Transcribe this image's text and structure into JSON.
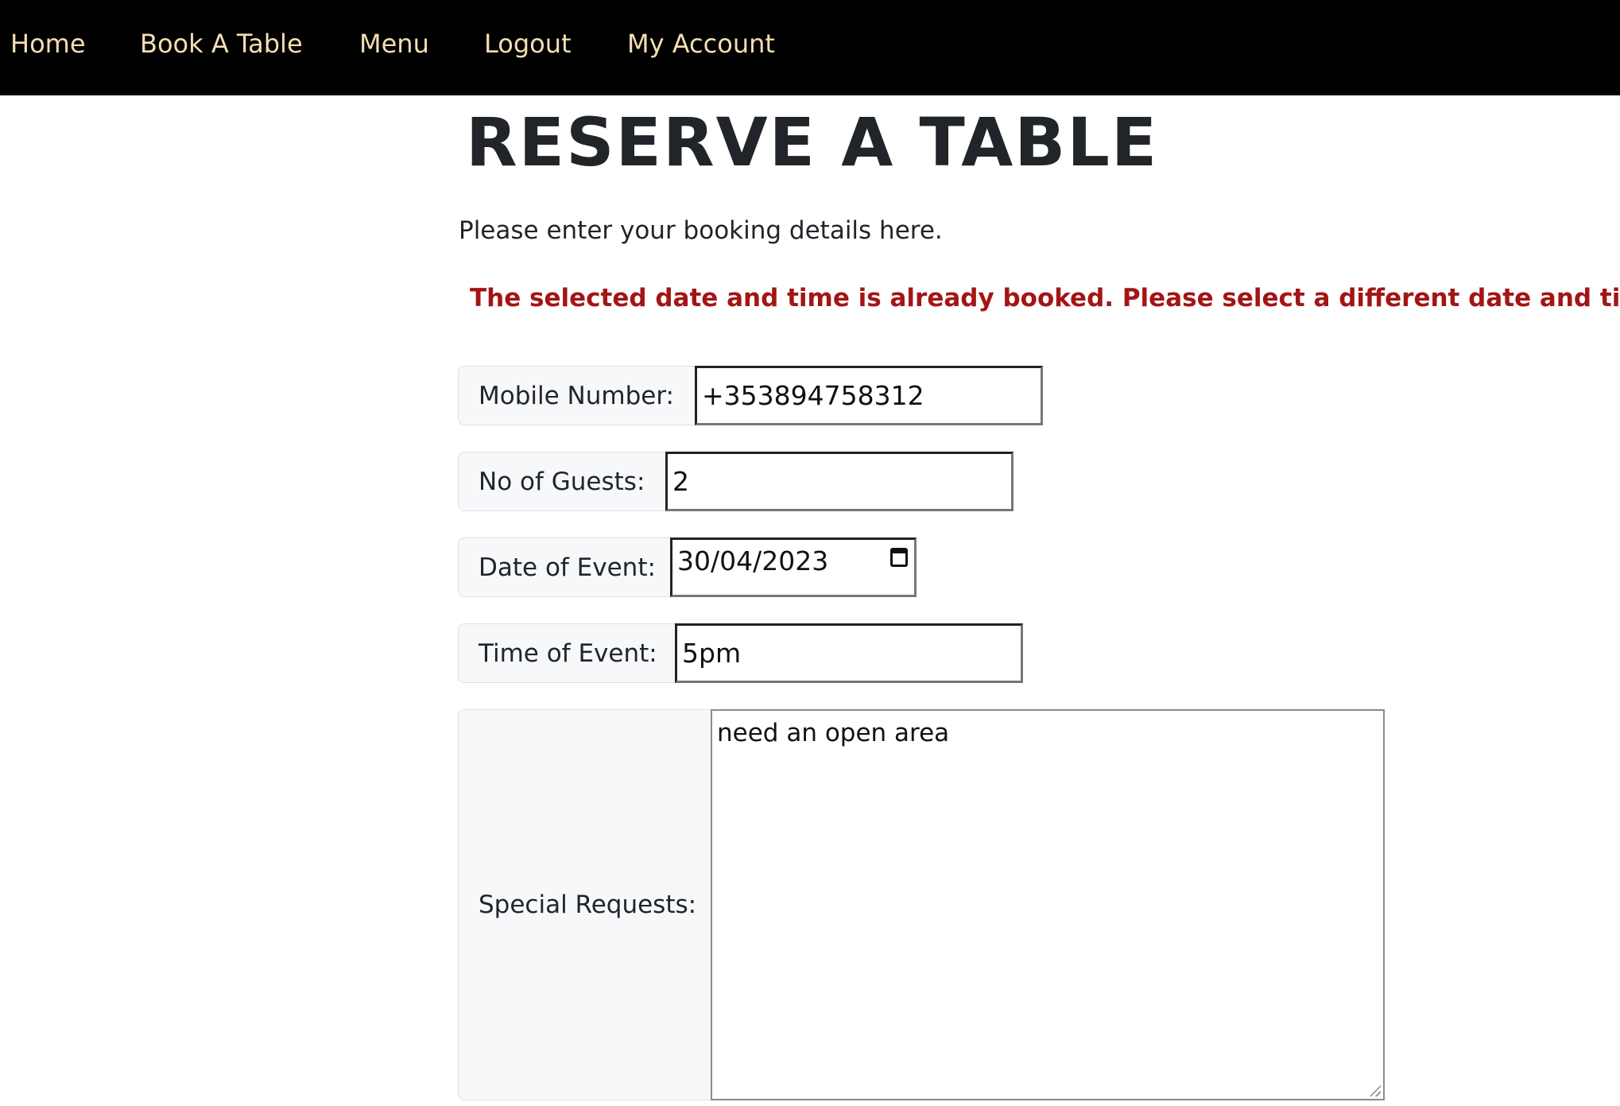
{
  "nav": {
    "items": [
      {
        "label": "Home"
      },
      {
        "label": "Book A Table"
      },
      {
        "label": "Menu"
      },
      {
        "label": "Logout"
      },
      {
        "label": "My Account"
      }
    ]
  },
  "page": {
    "title": "RESERVE A TABLE",
    "intro": "Please enter your booking details here.",
    "error": "The selected date and time is already booked. Please select a different date and time."
  },
  "form": {
    "mobile": {
      "label": "Mobile Number:",
      "value": "+353894758312"
    },
    "guests": {
      "label": "No of Guests:",
      "value": "2"
    },
    "date": {
      "label": "Date of Event:",
      "value": "30/04/2023",
      "icon": "calendar-icon"
    },
    "time": {
      "label": "Time of Event:",
      "value": "5pm"
    },
    "requests": {
      "label": "Special Requests:",
      "value": "need an open area"
    }
  },
  "colors": {
    "navbar_bg": "#000000",
    "nav_link": "#f5deb3",
    "error_text": "#a31515",
    "label_bg": "#f7f8fa"
  }
}
